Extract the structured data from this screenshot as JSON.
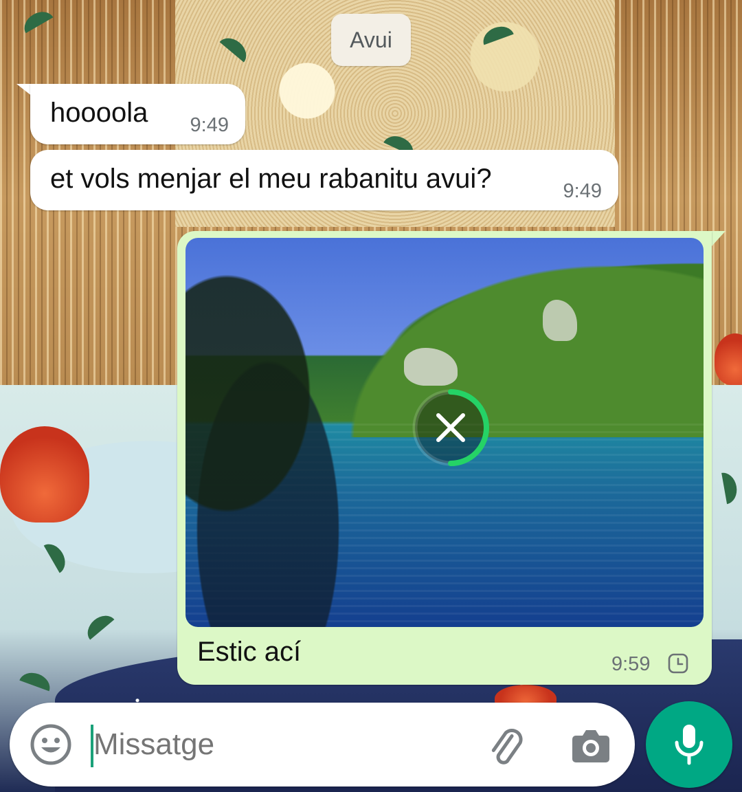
{
  "date_separator": "Avui",
  "messages": [
    {
      "direction": "incoming",
      "text": "hoooola",
      "time": "9:49"
    },
    {
      "direction": "incoming",
      "text": "et vols menjar el meu rabanitu avui?",
      "time": "9:49"
    },
    {
      "direction": "outgoing",
      "type": "image",
      "caption": "Estic ací",
      "time": "9:59",
      "status_icon": "clock-pending-icon",
      "download_progress": 0.5
    }
  ],
  "composer": {
    "placeholder": "Missatge",
    "left_icon": "emoji-icon",
    "right_icons": [
      "paperclip-icon",
      "camera-icon"
    ],
    "send_button_icon": "microphone-icon"
  },
  "colors": {
    "incoming_bubble": "#ffffff",
    "outgoing_bubble": "#dcf8c6",
    "accent": "#00a884",
    "progress": "#25d366"
  }
}
